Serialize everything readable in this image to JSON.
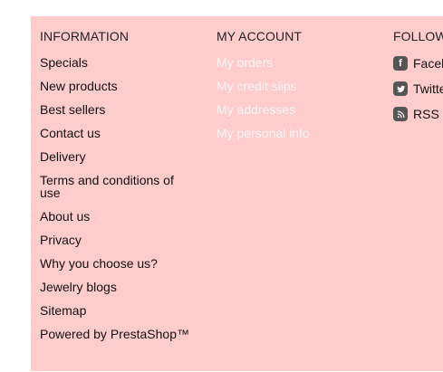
{
  "information": {
    "title": "INFORMATION",
    "links": [
      "Specials",
      "New products",
      "Best sellers",
      "Contact us",
      "Delivery",
      "Terms and conditions of use",
      "About us",
      "Privacy",
      "Why you choose us?",
      "Jewelry blogs",
      "Sitemap",
      "Powered by PrestaShop™"
    ]
  },
  "account": {
    "title": "MY ACCOUNT",
    "links": [
      "My orders",
      "My credit slips",
      "My addresses",
      "My personal info"
    ]
  },
  "follow": {
    "title": "FOLLOW US",
    "links": [
      {
        "label": "Facebook",
        "icon": "facebook-icon"
      },
      {
        "label": "Twitter",
        "icon": "twitter-icon"
      },
      {
        "label": "RSS",
        "icon": "rss-icon"
      }
    ]
  },
  "colors": {
    "panel_background": "#ffcccc",
    "account_link": "#f7f7f7",
    "icon_background": "#555555"
  }
}
